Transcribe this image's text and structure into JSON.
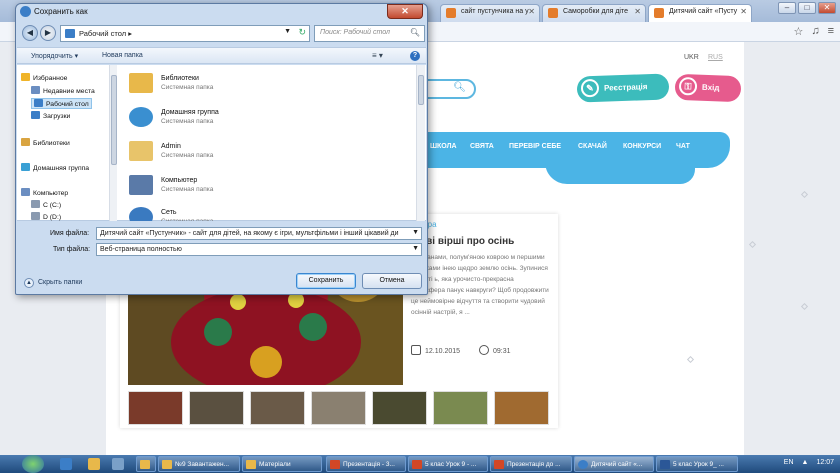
{
  "browser": {
    "tabs": [
      {
        "label": "",
        "color": "#6b8ec1"
      },
      {
        "label": "",
        "color": "#6b8ec1"
      },
      {
        "label": "",
        "color": "#6b8ec1"
      },
      {
        "label": "сайт пустунчика на у",
        "color": "#e47c2b"
      },
      {
        "label": "Саморобки для діте",
        "color": "#e47c2b"
      },
      {
        "label": "Дитячий сайт «Пусту",
        "color": "#e47c2b"
      }
    ],
    "win_min": "–",
    "win_max": "□",
    "win_close": "✕",
    "toolbar_icons": [
      "☆",
      "♫",
      "≡"
    ]
  },
  "site": {
    "lang_ukr": "UKR",
    "lang_rus": "RUS",
    "register_label": "Реєстрація",
    "login_label": "Вхід",
    "nav": [
      "ШКОЛА",
      "СВЯТА",
      "ПЕРЕВІР СЕБЕ",
      "СКАЧАЙ",
      "КОНКУРСИ",
      "ЧАТ"
    ],
    "article": {
      "tag": "тура",
      "title": "ові вірші про осінь",
      "excerpt": "и туманами, полум'яною коврою м першими іскорками інею щедро землю осінь. Зупинися на миті ь, яка урочисто-прекрасна атмосфера панує навкруги? Щоб продовжити це неймовірне відчуття та створити чудовий осінній настрій, я ...",
      "date": "12.10.2015",
      "time": "09:31"
    },
    "thumbs": [
      "#7a3a2a",
      "#5a5040",
      "#6a5a48",
      "#8a8070",
      "#4a4a30",
      "#7a8a50",
      "#a06a30"
    ]
  },
  "dialog": {
    "title": "Сохранить как",
    "close": "✕",
    "address": "Рабочий стол",
    "address_arrow": "▸",
    "search_placeholder": "Поиск: Рабочий стол",
    "organize": "Упорядочить ▾",
    "new_folder": "Новая папка",
    "view_icon": "≡ ▾",
    "help": "?",
    "nav_items": [
      {
        "label": "Избранное",
        "color": "#f0b429"
      },
      {
        "label": "Недавние места",
        "color": "#6b8ec1"
      },
      {
        "label": "Рабочий стол",
        "color": "#3b7ec7"
      },
      {
        "label": "Загрузки",
        "color": "#3b7ec7"
      },
      {
        "label": "Библиотеки",
        "color": "#d9a441"
      },
      {
        "label": "Домашняя группа",
        "color": "#3aa0d5"
      },
      {
        "label": "Компьютер",
        "color": "#6b8ec1"
      },
      {
        "label": "C (C:)",
        "color": "#8a9ab0"
      },
      {
        "label": "D (D:)",
        "color": "#8a9ab0"
      }
    ],
    "files": [
      {
        "name": "Библиотеки",
        "type": "Системная папка",
        "color": "#e8b84a"
      },
      {
        "name": "Домашняя группа",
        "type": "Системная папка",
        "color": "#3a8fd0"
      },
      {
        "name": "Admin",
        "type": "Системная папка",
        "color": "#e8c46a"
      },
      {
        "name": "Компьютер",
        "type": "Системная папка",
        "color": "#5a7aa8"
      },
      {
        "name": "Сеть",
        "type": "Системная папка",
        "color": "#3a7ac0"
      }
    ],
    "filename_label": "Имя файла:",
    "filename_value": "Дитячий сайт «Пустунчик» - сайт для дітей, на якому є ігри, мультфільми і інший цікавий ди",
    "filetype_label": "Тип файла:",
    "filetype_value": "Веб-страница полностью",
    "hide_folders": "Скрыть папки",
    "save": "Сохранить",
    "cancel": "Отмена"
  },
  "taskbar": {
    "items": [
      {
        "label": "",
        "color": "#e8b84a"
      },
      {
        "label": "№9 Завантажен...",
        "color": "#e8b84a"
      },
      {
        "label": "Матеріали",
        "color": "#e8b84a"
      },
      {
        "label": "Презентація - 3...",
        "color": "#d24726"
      },
      {
        "label": "5 клас Урок 9 - ...",
        "color": "#d24726"
      },
      {
        "label": "Презентація до ...",
        "color": "#d24726"
      },
      {
        "label": "Дитячий сайт «...",
        "color": "#3b7ec7"
      },
      {
        "label": "5 клас Урок 9_ ...",
        "color": "#2b5797"
      }
    ],
    "lang": "EN",
    "time": "12:07"
  }
}
